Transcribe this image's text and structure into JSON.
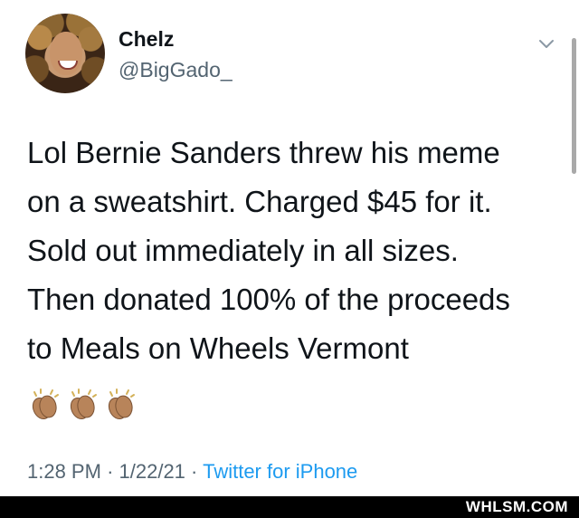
{
  "tweet": {
    "author": {
      "display_name": "Chelz",
      "handle": "@BigGado_"
    },
    "text": "Lol Bernie Sanders threw his meme\non a sweatshirt. Charged $45 for it.\nSold out immediately in all sizes.\nThen donated 100% of the proceeds\nto Meals on Wheels Vermont",
    "emojis": [
      "clapping-hands-emoji",
      "clapping-hands-emoji",
      "clapping-hands-emoji"
    ],
    "time": "1:28 PM",
    "date": "1/22/21",
    "separator": "·",
    "source": "Twitter for iPhone",
    "icons": {
      "menu": "chevron-down-icon",
      "avatar": "profile-photo"
    }
  },
  "watermark": {
    "text": "WHLSM.COM"
  },
  "colors": {
    "text": "#0f1419",
    "secondary": "#536471",
    "link": "#1d9bf0",
    "footer": "#000000",
    "clap_skin": "#b8845a"
  }
}
